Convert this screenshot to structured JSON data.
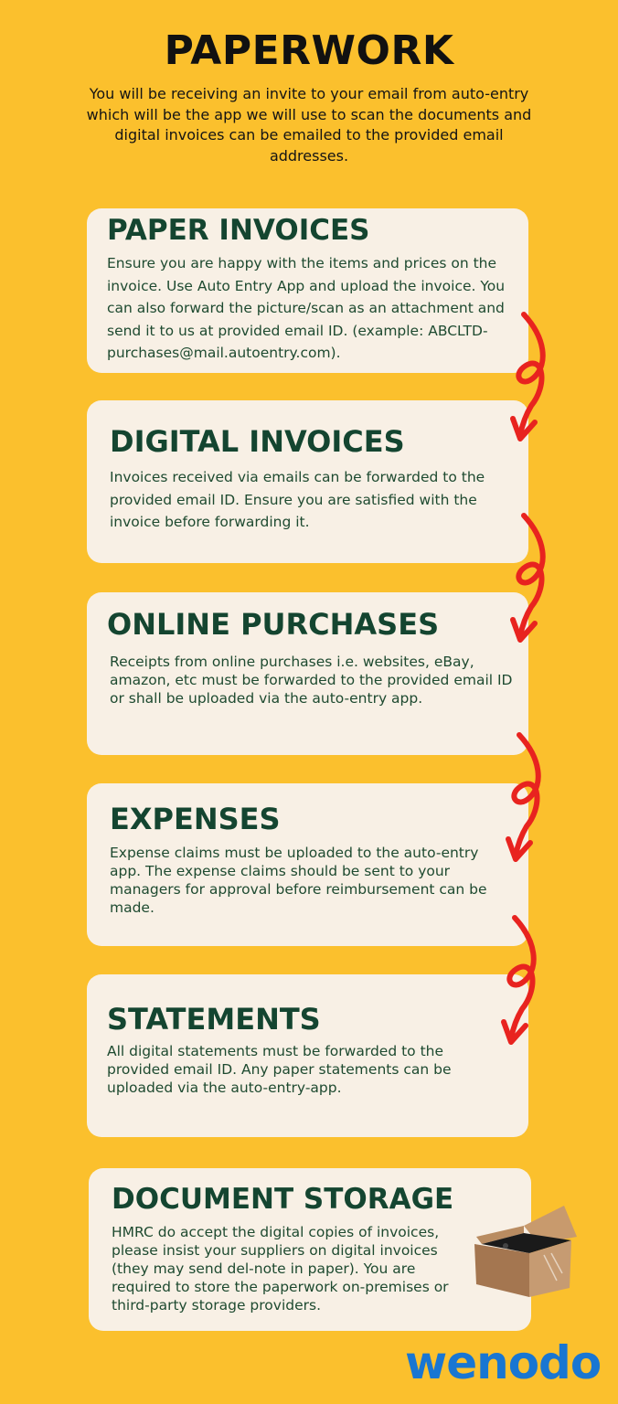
{
  "title": "PAPERWORK",
  "intro": "You will be receiving an invite to your email from auto-entry which will be the app we will use to scan the documents and digital invoices can be emailed to the provided email addresses.",
  "sections": [
    {
      "heading": "PAPER INVOICES",
      "body": "Ensure you are happy with the items and prices on the invoice. Use Auto Entry App and upload the invoice. You can also forward the picture/scan as an attachment and send it to us at provided email ID. (example: ABCLTD-purchases@mail.autoentry.com)."
    },
    {
      "heading": "DIGITAL INVOICES",
      "body": "Invoices received via emails can be forwarded to the provided email ID. Ensure you are satisfied with the invoice before forwarding it."
    },
    {
      "heading": "ONLINE PURCHASES",
      "body": "Receipts from online purchases i.e. websites, eBay, amazon, etc must be forwarded to the provided email ID or shall be uploaded via the auto-entry app."
    },
    {
      "heading": "EXPENSES",
      "body": "Expense claims must be uploaded to the auto-entry app. The expense claims should be sent to your managers for approval before reimbursement can be made."
    },
    {
      "heading": "STATEMENTS",
      "body": "All digital statements must be forwarded to the provided email ID. Any paper statements can be uploaded via the auto-entry-app."
    },
    {
      "heading": "DOCUMENT STORAGE",
      "body": "HMRC do accept the digital copies of invoices, please insist your suppliers on digital invoices (they may send del-note in paper). You are required to store the paperwork on-premises or third-party storage providers."
    }
  ],
  "logo": "wenodo",
  "colors": {
    "background": "#FBC02D",
    "card": "#F8F0E5",
    "heading": "#144530",
    "arrow": "#E8231F",
    "logo": "#1976D2"
  },
  "icons": [
    "curly-arrow-icon",
    "open-box-icon"
  ]
}
